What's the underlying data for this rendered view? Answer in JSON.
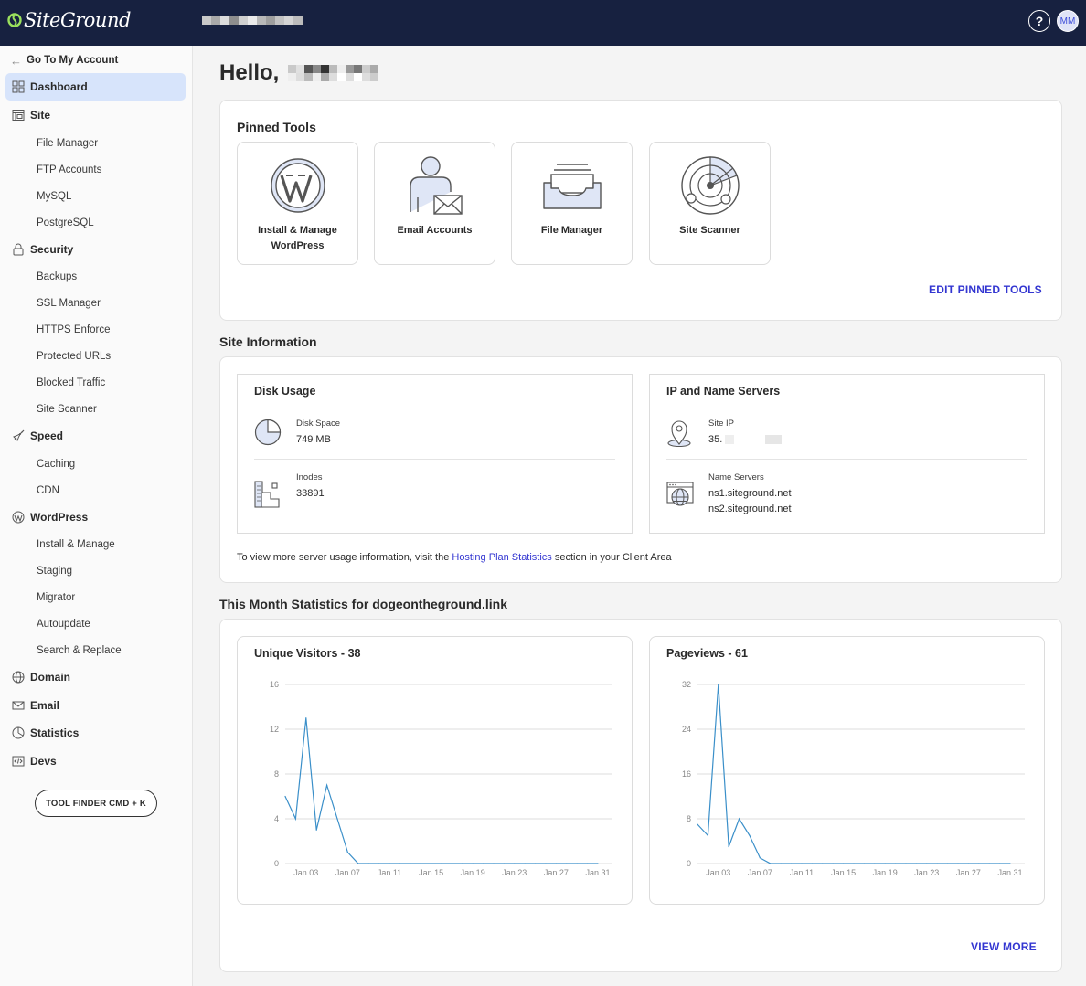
{
  "header": {
    "logo_text": "SiteGround",
    "help_label": "?",
    "avatar_initials": "MM"
  },
  "sidebar": {
    "back_label": "Go To My Account",
    "items": [
      {
        "label": "Dashboard",
        "icon": "dashboard-icon",
        "active": true
      },
      {
        "label": "Site",
        "icon": "site-icon"
      },
      {
        "label": "File Manager",
        "sub": true
      },
      {
        "label": "FTP Accounts",
        "sub": true
      },
      {
        "label": "MySQL",
        "sub": true
      },
      {
        "label": "PostgreSQL",
        "sub": true
      },
      {
        "label": "Security",
        "icon": "lock-icon"
      },
      {
        "label": "Backups",
        "sub": true
      },
      {
        "label": "SSL Manager",
        "sub": true
      },
      {
        "label": "HTTPS Enforce",
        "sub": true
      },
      {
        "label": "Protected URLs",
        "sub": true
      },
      {
        "label": "Blocked Traffic",
        "sub": true
      },
      {
        "label": "Site Scanner",
        "sub": true
      },
      {
        "label": "Speed",
        "icon": "rocket-icon"
      },
      {
        "label": "Caching",
        "sub": true
      },
      {
        "label": "CDN",
        "sub": true
      },
      {
        "label": "WordPress",
        "icon": "wordpress-icon"
      },
      {
        "label": "Install & Manage",
        "sub": true
      },
      {
        "label": "Staging",
        "sub": true
      },
      {
        "label": "Migrator",
        "sub": true
      },
      {
        "label": "Autoupdate",
        "sub": true
      },
      {
        "label": "Search & Replace",
        "sub": true
      },
      {
        "label": "Domain",
        "icon": "globe-icon"
      },
      {
        "label": "Email",
        "icon": "envelope-icon"
      },
      {
        "label": "Statistics",
        "icon": "pie-chart-icon"
      },
      {
        "label": "Devs",
        "icon": "code-icon"
      }
    ],
    "tool_finder_label": "TOOL FINDER CMD + K"
  },
  "main": {
    "greeting": "Hello,",
    "pinned_tools": {
      "title": "Pinned Tools",
      "tools": [
        {
          "label": "Install & Manage WordPress",
          "icon": "wordpress-logo-icon"
        },
        {
          "label": "Email Accounts",
          "icon": "person-envelope-icon"
        },
        {
          "label": "File Manager",
          "icon": "file-tray-icon"
        },
        {
          "label": "Site Scanner",
          "icon": "radar-icon"
        }
      ],
      "edit_label": "EDIT PINNED TOOLS"
    },
    "site_info": {
      "title": "Site Information",
      "disk_usage": {
        "title": "Disk Usage",
        "disk_space_label": "Disk Space",
        "disk_space_value": "749 MB",
        "inodes_label": "Inodes",
        "inodes_value": "33891"
      },
      "ip_servers": {
        "title": "IP and Name Servers",
        "site_ip_label": "Site IP",
        "site_ip_value": "35.",
        "name_servers_label": "Name Servers",
        "ns1": "ns1.siteground.net",
        "ns2": "ns2.siteground.net"
      },
      "note_prefix": "To view more server usage information, visit the ",
      "note_link": "Hosting Plan Statistics",
      "note_suffix": " section in your Client Area"
    },
    "stats": {
      "title": "This Month Statistics for dogeontheground.link",
      "view_more_label": "VIEW MORE"
    },
    "colors": {
      "accent": "#3336d1",
      "header_bg": "#172140",
      "chart_line": "#3a8fc9"
    }
  },
  "chart_data": [
    {
      "type": "line",
      "title": "Unique Visitors - 38",
      "x": [
        "Jan 01",
        "Jan 02",
        "Jan 03",
        "Jan 04",
        "Jan 05",
        "Jan 06",
        "Jan 07",
        "Jan 08",
        "Jan 09",
        "Jan 10",
        "Jan 11",
        "Jan 12",
        "Jan 13",
        "Jan 14",
        "Jan 15",
        "Jan 16",
        "Jan 17",
        "Jan 18",
        "Jan 19",
        "Jan 20",
        "Jan 21",
        "Jan 22",
        "Jan 23",
        "Jan 24",
        "Jan 25",
        "Jan 26",
        "Jan 27",
        "Jan 28",
        "Jan 29",
        "Jan 30",
        "Jan 31"
      ],
      "values": [
        6,
        4,
        13,
        3,
        7,
        4,
        1,
        0,
        0,
        0,
        0,
        0,
        0,
        0,
        0,
        0,
        0,
        0,
        0,
        0,
        0,
        0,
        0,
        0,
        0,
        0,
        0,
        0,
        0,
        0,
        0
      ],
      "x_tick_labels": [
        "Jan 03",
        "Jan 07",
        "Jan 11",
        "Jan 15",
        "Jan 19",
        "Jan 23",
        "Jan 27",
        "Jan 31"
      ],
      "y_ticks": [
        0,
        4,
        8,
        12,
        16
      ],
      "ylim": [
        0,
        16
      ],
      "grid": true
    },
    {
      "type": "line",
      "title": "Pageviews - 61",
      "x": [
        "Jan 01",
        "Jan 02",
        "Jan 03",
        "Jan 04",
        "Jan 05",
        "Jan 06",
        "Jan 07",
        "Jan 08",
        "Jan 09",
        "Jan 10",
        "Jan 11",
        "Jan 12",
        "Jan 13",
        "Jan 14",
        "Jan 15",
        "Jan 16",
        "Jan 17",
        "Jan 18",
        "Jan 19",
        "Jan 20",
        "Jan 21",
        "Jan 22",
        "Jan 23",
        "Jan 24",
        "Jan 25",
        "Jan 26",
        "Jan 27",
        "Jan 28",
        "Jan 29",
        "Jan 30",
        "Jan 31"
      ],
      "values": [
        7,
        5,
        32,
        3,
        8,
        5,
        1,
        0,
        0,
        0,
        0,
        0,
        0,
        0,
        0,
        0,
        0,
        0,
        0,
        0,
        0,
        0,
        0,
        0,
        0,
        0,
        0,
        0,
        0,
        0,
        0
      ],
      "x_tick_labels": [
        "Jan 03",
        "Jan 07",
        "Jan 11",
        "Jan 15",
        "Jan 19",
        "Jan 23",
        "Jan 27",
        "Jan 31"
      ],
      "y_ticks": [
        0,
        8,
        16,
        24,
        32
      ],
      "ylim": [
        0,
        32
      ],
      "grid": true
    }
  ]
}
